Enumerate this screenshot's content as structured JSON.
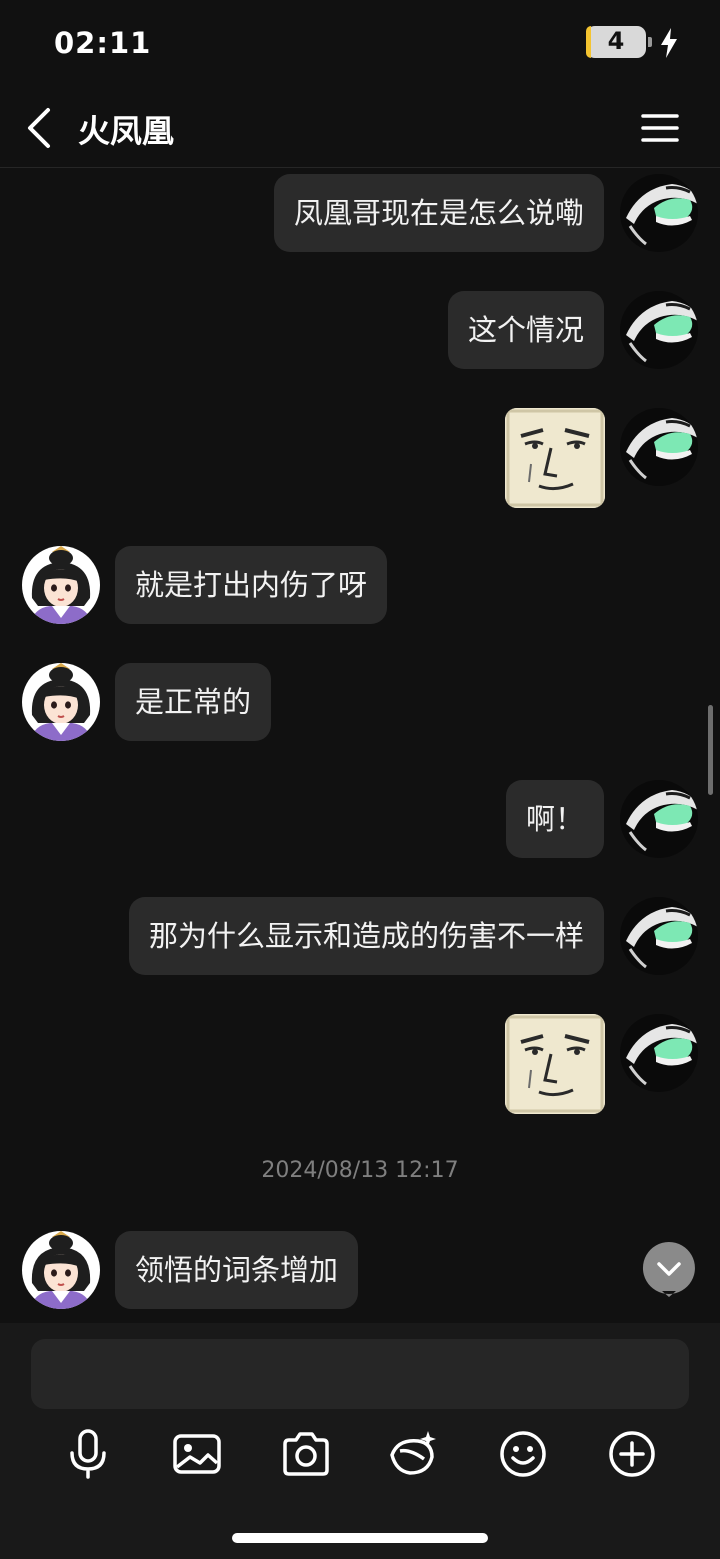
{
  "status_bar": {
    "time": "02:11",
    "battery_level": "4",
    "icons": [
      "battery-icon",
      "charging-bolt-icon"
    ]
  },
  "header": {
    "title": "火凤凰",
    "icons": [
      "back-arrow-icon",
      "menu-icon"
    ]
  },
  "messages": [
    {
      "side": "right",
      "type": "text",
      "text": "凤凰哥现在是怎么说嘞"
    },
    {
      "side": "right",
      "type": "text",
      "text": "这个情况"
    },
    {
      "side": "right",
      "type": "sticker",
      "sticker": "smug-face-sticker"
    },
    {
      "side": "left",
      "type": "text",
      "text": "就是打出内伤了呀"
    },
    {
      "side": "left",
      "type": "text",
      "text": "是正常的"
    },
    {
      "side": "right",
      "type": "text",
      "text": "啊！"
    },
    {
      "side": "right",
      "type": "text",
      "text": "那为什么显示和造成的伤害不一样"
    },
    {
      "side": "right",
      "type": "sticker",
      "sticker": "smug-face-sticker"
    },
    {
      "side": "left",
      "type": "text",
      "text": "领悟的词条增加"
    }
  ],
  "timestamp": "2024/08/13 12:17",
  "input": {
    "value": "",
    "placeholder": ""
  },
  "toolbar": [
    "microphone-icon",
    "image-icon",
    "camera-icon",
    "creative-icon",
    "emoji-icon",
    "plus-icon"
  ],
  "colors": {
    "background": "#111111",
    "bubble": "#2b2b2b",
    "input_bar": "#191919",
    "accent_green": "#7de8b4"
  }
}
